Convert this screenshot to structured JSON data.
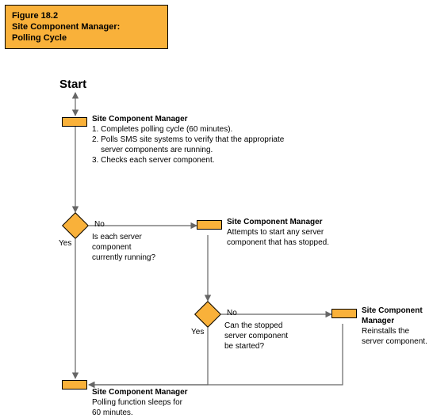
{
  "title": {
    "line1": "Figure 18.2",
    "line2": "Site Component Manager:",
    "line3": "Polling Cycle"
  },
  "start": "Start",
  "nodeA": {
    "heading": "Site Component Manager",
    "l1": "1. Completes polling cycle (60 minutes).",
    "l2": "2. Polls SMS site systems to verify that the appropriate",
    "l2b": "    server components are running.",
    "l3": "3. Checks each server component."
  },
  "decision1": {
    "no": "No",
    "yes": "Yes",
    "q1": "Is each server",
    "q2": "component",
    "q3": "currently running?"
  },
  "nodeB": {
    "heading": "Site Component Manager",
    "l1": "Attempts to start any server",
    "l2": "component that has stopped."
  },
  "decision2": {
    "no": "No",
    "yes": "Yes",
    "q1": "Can the stopped",
    "q2": "server component",
    "q3": "be started?"
  },
  "nodeC": {
    "heading": "Site Component",
    "heading2": "Manager",
    "l1": "Reinstalls the",
    "l2": "server component."
  },
  "nodeD": {
    "heading": "Site Component Manager",
    "l1": "Polling function sleeps for",
    "l2": "60 minutes."
  },
  "chart_data": {
    "type": "flowchart",
    "title": "Figure 18.2 Site Component Manager: Polling Cycle",
    "nodes": [
      {
        "id": "start",
        "type": "start",
        "label": "Start"
      },
      {
        "id": "A",
        "type": "process",
        "label": "Site Component Manager: 1. Completes polling cycle (60 minutes). 2. Polls SMS site systems to verify that the appropriate server components are running. 3. Checks each server component."
      },
      {
        "id": "D1",
        "type": "decision",
        "label": "Is each server component currently running?"
      },
      {
        "id": "B",
        "type": "process",
        "label": "Site Component Manager: Attempts to start any server component that has stopped."
      },
      {
        "id": "D2",
        "type": "decision",
        "label": "Can the stopped server component be started?"
      },
      {
        "id": "C",
        "type": "process",
        "label": "Site Component Manager: Reinstalls the server component."
      },
      {
        "id": "D",
        "type": "process",
        "label": "Site Component Manager: Polling function sleeps for 60 minutes."
      }
    ],
    "edges": [
      {
        "from": "start",
        "to": "A"
      },
      {
        "from": "A",
        "to": "D1"
      },
      {
        "from": "D1",
        "to": "D",
        "label": "Yes"
      },
      {
        "from": "D1",
        "to": "B",
        "label": "No"
      },
      {
        "from": "B",
        "to": "D2"
      },
      {
        "from": "D2",
        "to": "D",
        "label": "Yes"
      },
      {
        "from": "D2",
        "to": "C",
        "label": "No"
      },
      {
        "from": "C",
        "to": "D"
      }
    ]
  }
}
